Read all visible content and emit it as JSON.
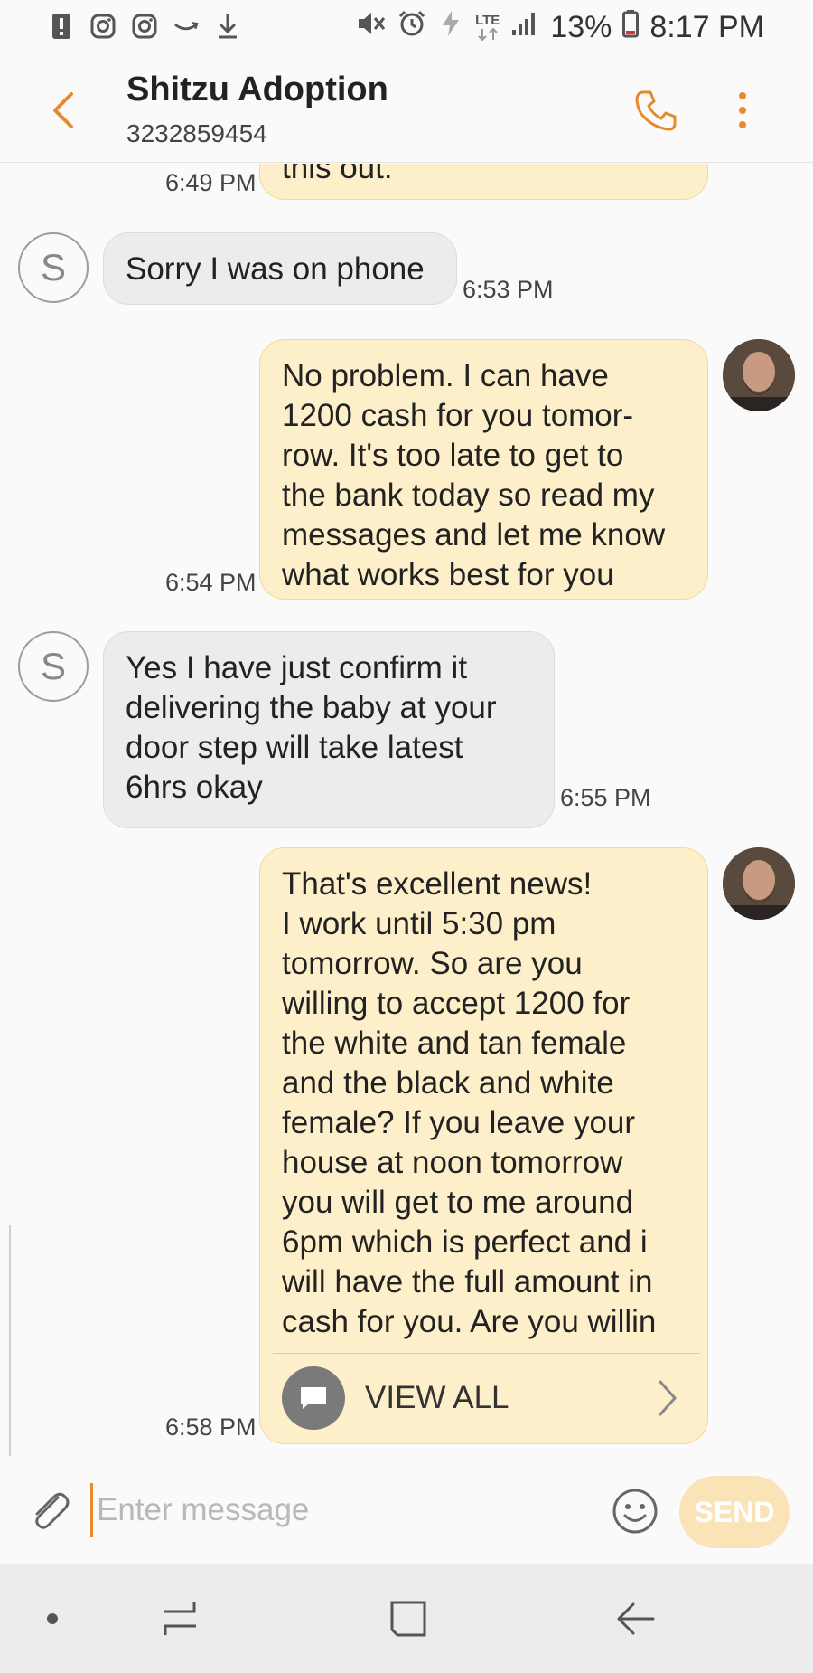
{
  "status_bar": {
    "icons_left": [
      "alert-icon",
      "instagram-icon",
      "instagram-icon",
      "amazon-icon",
      "download-icon"
    ],
    "icons_right": [
      "mute-icon",
      "alarm-icon",
      "data-saver-icon",
      "lte-icon",
      "signal-icon",
      "battery-icon"
    ],
    "lte_label": "LTE",
    "battery_percent": "13%",
    "time": "8:17 PM"
  },
  "header": {
    "title": "Shitzu Adoption",
    "phone": "3232859454"
  },
  "colors": {
    "accent": "#e8892b",
    "outgoing_bubble": "#fdefc9",
    "incoming_bubble": "#ececec",
    "send_disabled": "#fbe3b8"
  },
  "messages": [
    {
      "direction": "out",
      "text": "this out.",
      "time": "6:49 PM"
    },
    {
      "direction": "in",
      "avatar_letter": "S",
      "text": "Sorry I was on phone",
      "time": "6:53 PM"
    },
    {
      "direction": "out",
      "lines": [
        "No problem. I can have",
        "1200 cash for you tomor-",
        "row. It's too late to get to",
        "the bank today so read my",
        "messages and let me know",
        "what works best for you"
      ],
      "time": "6:54 PM"
    },
    {
      "direction": "in",
      "avatar_letter": "S",
      "lines": [
        "Yes I have just confirm it",
        "delivering the baby at your",
        "door step will take latest",
        "6hrs okay"
      ],
      "time": "6:55 PM"
    },
    {
      "direction": "out",
      "lines": [
        "That's excellent news!",
        "I work until 5:30 pm",
        "tomorrow. So are you",
        "willing to accept 1200 for",
        "the white and tan female",
        "and the black and white",
        "female? If you leave your",
        "house at noon tomorrow",
        "you will get to me around",
        "6pm which is perfect and i",
        "will have the full amount in",
        "cash for you. Are you willin"
      ],
      "time": "6:58 PM",
      "view_all_label": "VIEW ALL"
    }
  ],
  "composer": {
    "placeholder": "Enter message",
    "value": "",
    "send_label": "SEND"
  },
  "nav": [
    "dot-icon",
    "recent-apps-icon",
    "home-icon",
    "back-icon"
  ]
}
